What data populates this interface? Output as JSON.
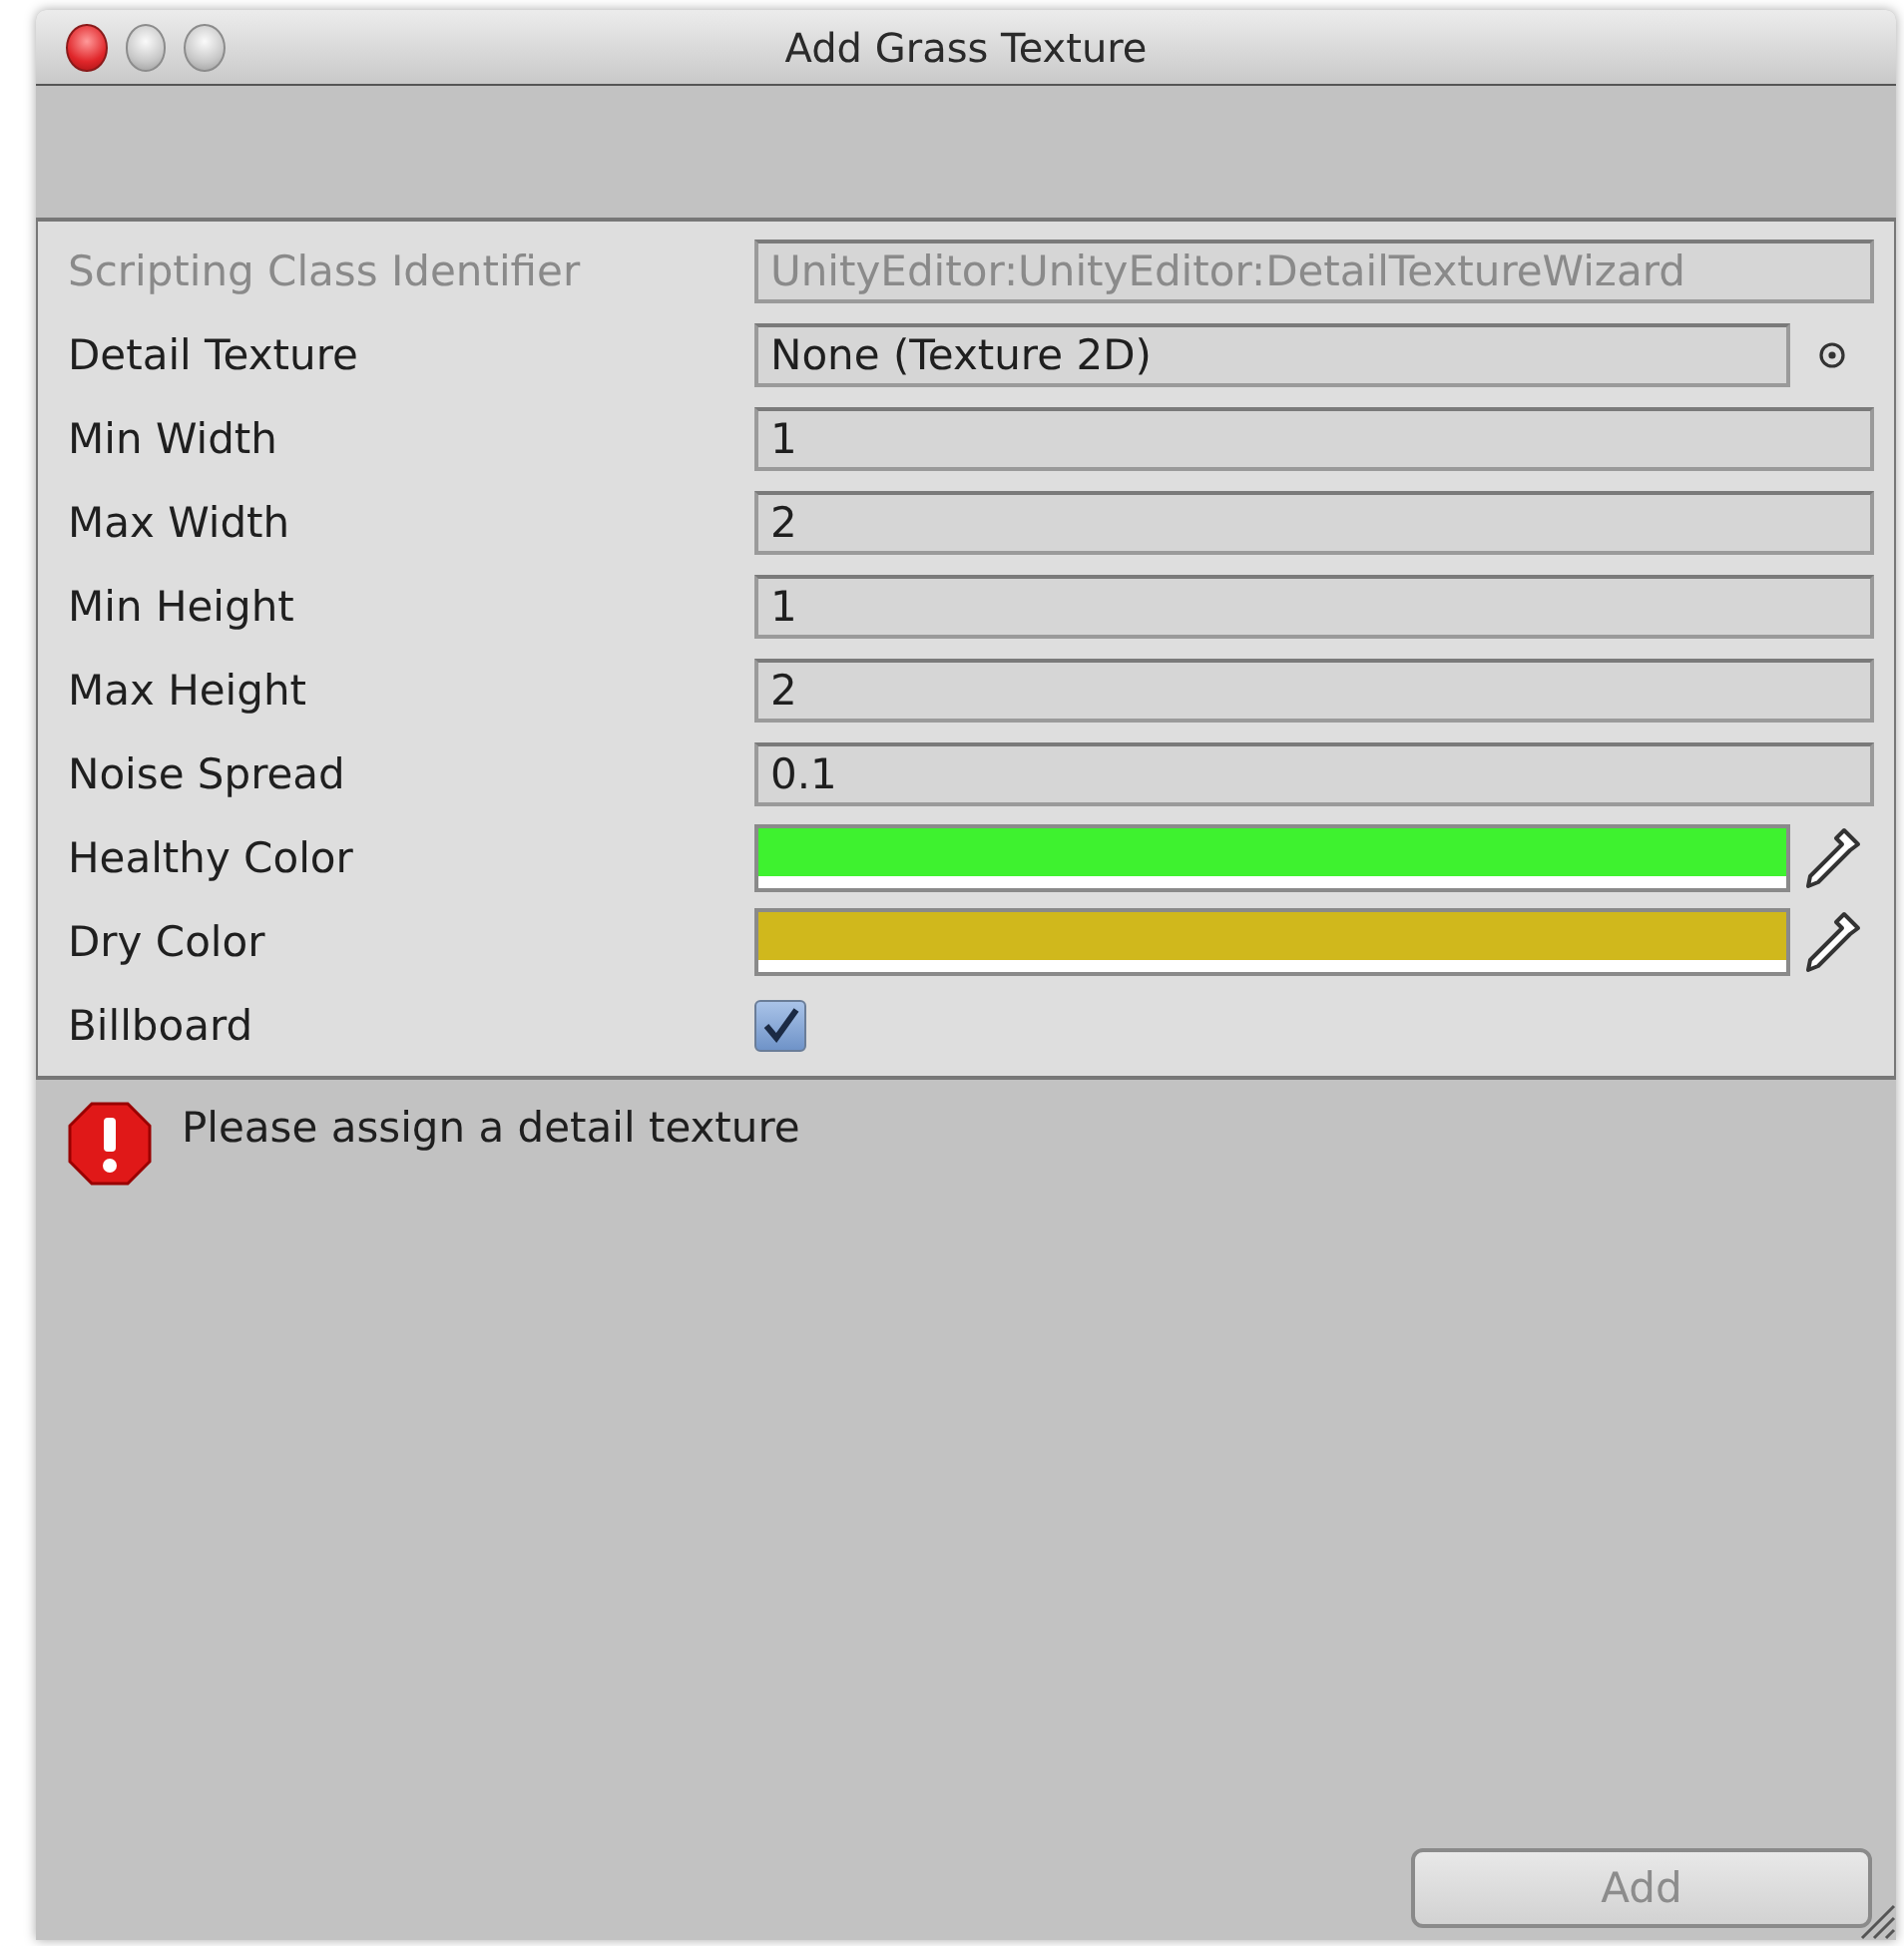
{
  "window": {
    "title": "Add Grass Texture"
  },
  "fields": [
    {
      "kind": "text",
      "label": "Scripting Class Identifier",
      "value": "UnityEditor:UnityEditor:DetailTextureWizard",
      "disabled": true
    },
    {
      "kind": "object",
      "label": "Detail Texture",
      "value": "None (Texture 2D)",
      "disabled": false
    },
    {
      "kind": "text",
      "label": "Min Width",
      "value": "1",
      "disabled": false
    },
    {
      "kind": "text",
      "label": "Max Width",
      "value": "2",
      "disabled": false
    },
    {
      "kind": "text",
      "label": "Min Height",
      "value": "1",
      "disabled": false
    },
    {
      "kind": "text",
      "label": "Max Height",
      "value": "2",
      "disabled": false
    },
    {
      "kind": "text",
      "label": "Noise Spread",
      "value": "0.1",
      "disabled": false
    },
    {
      "kind": "color",
      "label": "Healthy Color",
      "color": "#3ef22f",
      "disabled": false
    },
    {
      "kind": "color",
      "label": "Dry Color",
      "color": "#d0b81c",
      "disabled": false
    },
    {
      "kind": "checkbox",
      "label": "Billboard",
      "checked": true,
      "disabled": false
    }
  ],
  "message": {
    "text": "Please assign a detail texture"
  },
  "add_button": {
    "label": "Add",
    "disabled": true
  }
}
